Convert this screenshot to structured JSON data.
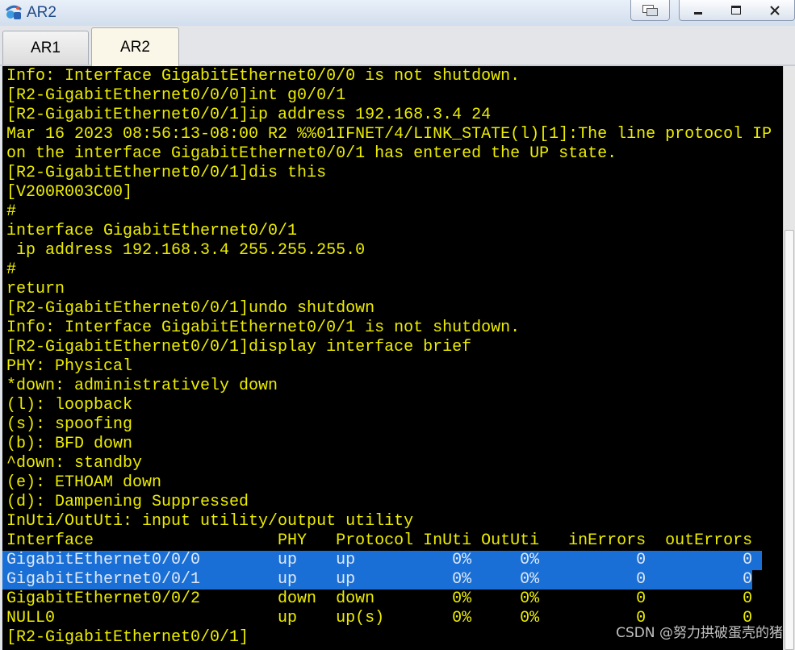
{
  "window": {
    "title": "AR2",
    "app_icon": "ensp-app-icon",
    "controls": {
      "tile": "tile-windows-icon",
      "minimize": "minimize-icon",
      "maximize": "maximize-icon",
      "close": "close-icon"
    }
  },
  "tabs": [
    {
      "label": "AR1",
      "active": false
    },
    {
      "label": "AR2",
      "active": true
    }
  ],
  "terminal": {
    "lines": [
      {
        "text": "Info: Interface GigabitEthernet0/0/0 is not shutdown."
      },
      {
        "text": "[R2-GigabitEthernet0/0/0]int g0/0/1"
      },
      {
        "text": "[R2-GigabitEthernet0/0/1]ip address 192.168.3.4 24"
      },
      {
        "text": "Mar 16 2023 08:56:13-08:00 R2 %%01IFNET/4/LINK_STATE(l)[1]:The line protocol IP"
      },
      {
        "text": "on the interface GigabitEthernet0/0/1 has entered the UP state."
      },
      {
        "text": "[R2-GigabitEthernet0/0/1]dis this"
      },
      {
        "text": "[V200R003C00]"
      },
      {
        "text": "#"
      },
      {
        "text": "interface GigabitEthernet0/0/1"
      },
      {
        "text": " ip address 192.168.3.4 255.255.255.0"
      },
      {
        "text": "#"
      },
      {
        "text": "return"
      },
      {
        "text": "[R2-GigabitEthernet0/0/1]undo shutdown"
      },
      {
        "text": "Info: Interface GigabitEthernet0/0/1 is not shutdown."
      },
      {
        "text": "[R2-GigabitEthernet0/0/1]display interface brief"
      },
      {
        "text": "PHY: Physical"
      },
      {
        "text": "*down: administratively down"
      },
      {
        "text": "(l): loopback"
      },
      {
        "text": "(s): spoofing"
      },
      {
        "text": "(b): BFD down"
      },
      {
        "text": "^down: standby"
      },
      {
        "text": "(e): ETHOAM down"
      },
      {
        "text": "(d): Dampening Suppressed"
      },
      {
        "text": "InUti/OutUti: input utility/output utility"
      },
      {
        "text": "Interface                   PHY   Protocol InUti OutUti   inErrors  outErrors"
      },
      {
        "text": "GigabitEthernet0/0/0        up    up          0%     0%          0          0",
        "selected": true
      },
      {
        "text": "GigabitEthernet0/0/1        up    up          0%     0%          0          0",
        "selected": true
      },
      {
        "text": "GigabitEthernet0/0/2        down  down        0%     0%          0          0"
      },
      {
        "text": "NULL0                       up    up(s)       0%     0%          0          0"
      },
      {
        "text": "[R2-GigabitEthernet0/0/1]"
      }
    ]
  },
  "scrollbar": {
    "scroll_percent": 100,
    "visible_percent": 72
  },
  "watermark": "CSDN @努力拱破蛋壳的猪",
  "colors": {
    "title_text": "#1f4a86",
    "terminal_background": "#000000",
    "terminal_text": "#eded00",
    "selection_background": "#1a6fd6",
    "selection_text": "#dde8f7",
    "active_tab": "#fbf7e8"
  }
}
